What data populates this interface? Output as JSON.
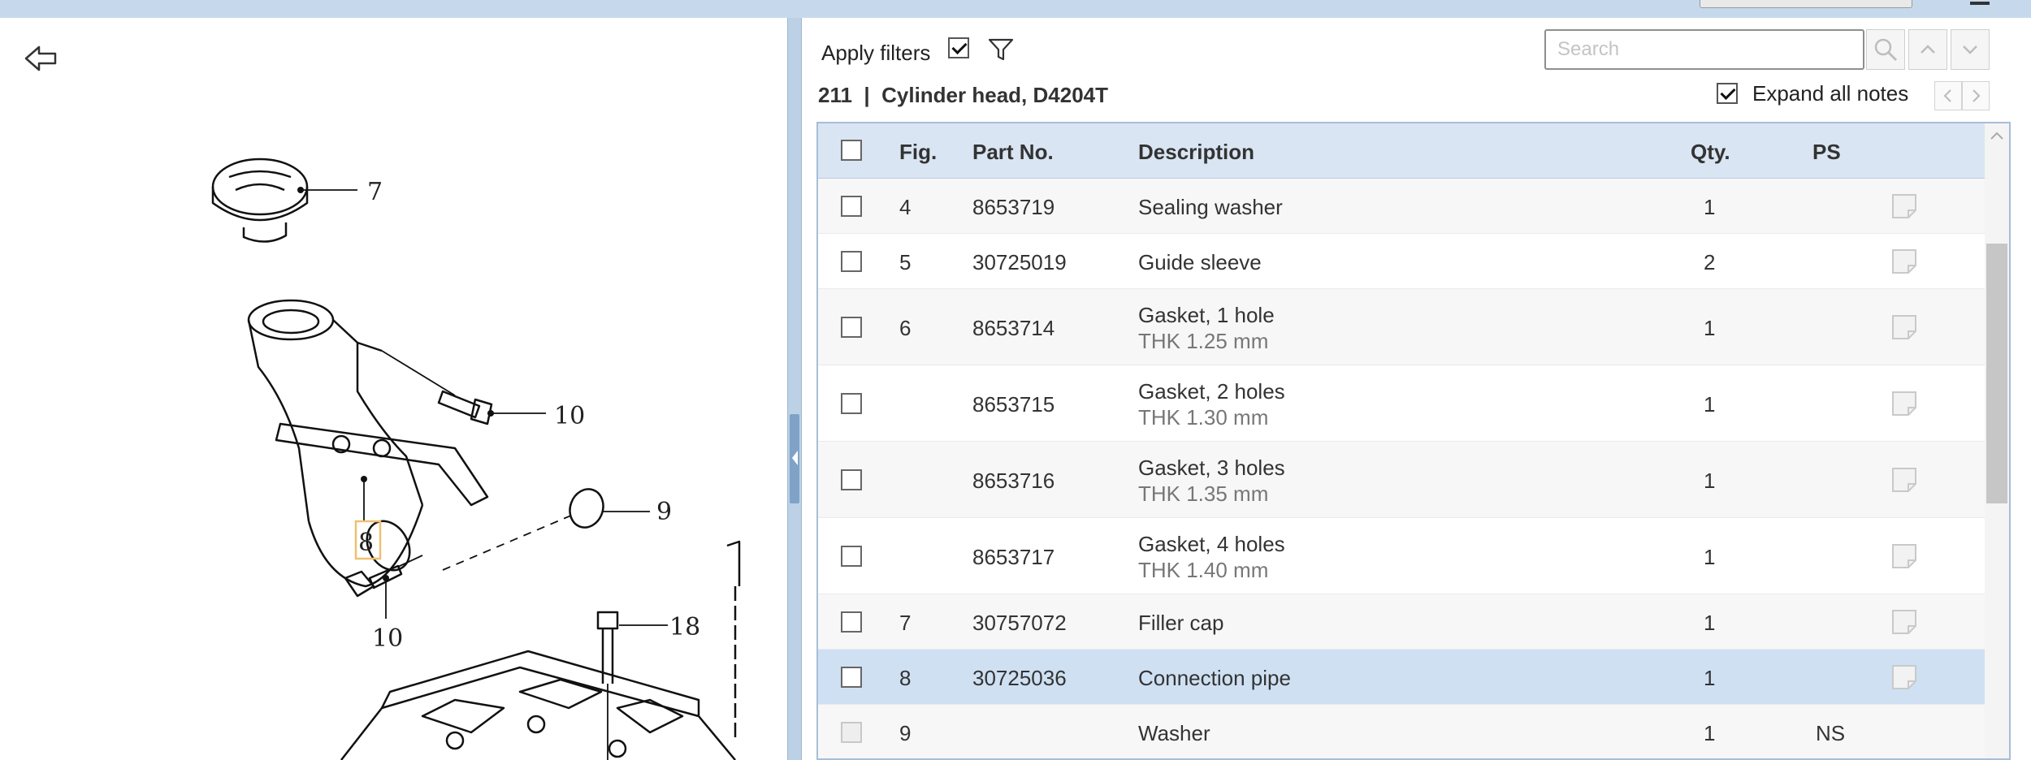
{
  "window": {
    "top_dropdown_value": ""
  },
  "filters": {
    "apply_label": "Apply filters",
    "apply_checked": true
  },
  "search": {
    "placeholder": "Search"
  },
  "group": {
    "title": "211  |  Cylinder head, D4204T"
  },
  "notes": {
    "expand_label": "Expand all notes",
    "expand_checked": true
  },
  "table": {
    "headers": {
      "fig": "Fig.",
      "part_no": "Part No.",
      "description": "Description",
      "qty": "Qty.",
      "ps": "PS"
    },
    "rows": [
      {
        "fig": "4",
        "part_no": "8653719",
        "desc": "Sealing washer",
        "sub": "",
        "qty": "1",
        "ps": ""
      },
      {
        "fig": "5",
        "part_no": "30725019",
        "desc": "Guide sleeve",
        "sub": "",
        "qty": "2",
        "ps": ""
      },
      {
        "fig": "6",
        "part_no": "8653714",
        "desc": "Gasket, 1 hole",
        "sub": "THK 1.25 mm",
        "qty": "1",
        "ps": ""
      },
      {
        "fig": "",
        "part_no": "8653715",
        "desc": "Gasket, 2 holes",
        "sub": "THK 1.30 mm",
        "qty": "1",
        "ps": ""
      },
      {
        "fig": "",
        "part_no": "8653716",
        "desc": "Gasket, 3 holes",
        "sub": "THK 1.35 mm",
        "qty": "1",
        "ps": ""
      },
      {
        "fig": "",
        "part_no": "8653717",
        "desc": "Gasket, 4 holes",
        "sub": "THK 1.40 mm",
        "qty": "1",
        "ps": ""
      },
      {
        "fig": "7",
        "part_no": "30757072",
        "desc": "Filler cap",
        "sub": "",
        "qty": "1",
        "ps": ""
      },
      {
        "fig": "8",
        "part_no": "30725036",
        "desc": "Connection pipe",
        "sub": "",
        "qty": "1",
        "ps": "",
        "selected": true
      },
      {
        "fig": "9",
        "part_no": "",
        "desc": "Washer",
        "sub": "",
        "qty": "1",
        "ps": "NS",
        "disabled": true
      }
    ]
  },
  "diagram": {
    "callouts": [
      "7",
      "10",
      "9",
      "8",
      "10",
      "18"
    ],
    "highlighted_callout": "8"
  },
  "colors": {
    "header_bg": "#d9e5f2",
    "selected_row": "#cfe0f3",
    "frame": "#c9dbed"
  }
}
